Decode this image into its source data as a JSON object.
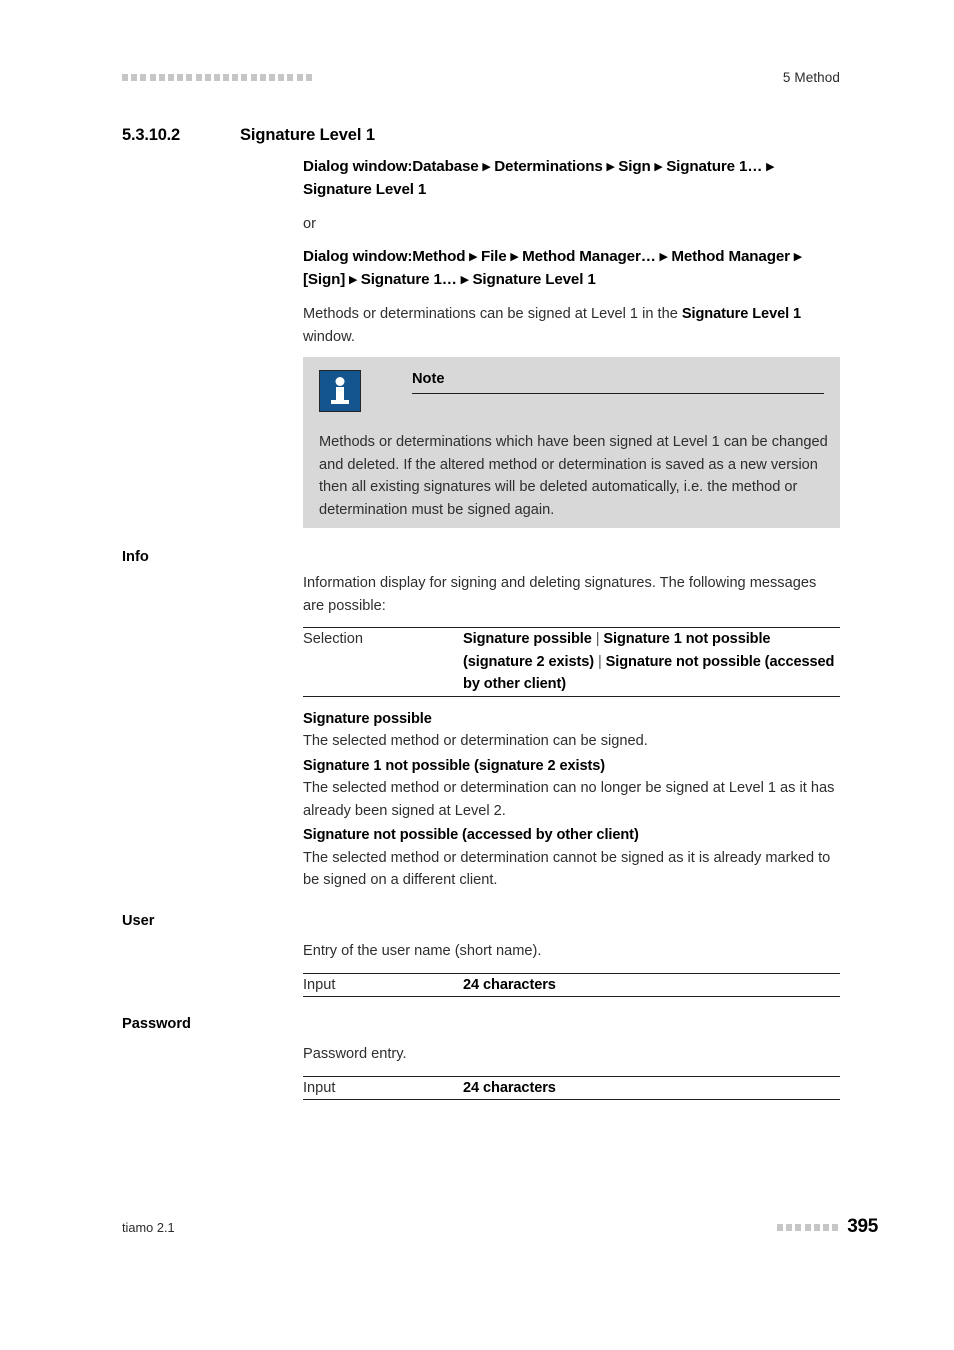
{
  "header": {
    "decor_squares": 21,
    "chapter": "5 Method"
  },
  "section": {
    "number": "5.3.10.2",
    "title": "Signature Level 1"
  },
  "breadcrumbs": {
    "path_1": "Dialog window:Database ▸ Determinations ▸ Sign ▸ Signature 1… ▸ Signature Level 1",
    "separator_word": "or",
    "path_2": "Dialog window:Method ▸ File ▸ Method Manager… ▸ Method Manager ▸ [Sign] ▸ Signature 1… ▸ Signature Level 1"
  },
  "intro": {
    "text_before": "Methods or determinations can be signed at Level 1 in the ",
    "emphasis": "Signature Level 1",
    "text_after": " window."
  },
  "note": {
    "icon": "info-icon",
    "title": "Note",
    "body": "Methods or determinations which have been signed at Level 1 can be changed and deleted. If the altered method or determination is saved as a new version then all existing signatures will be deleted automatically, i.e. the method or determination must be signed again.",
    "background_color": "#d8d8d8",
    "icon_color": "#14558f"
  },
  "info_section": {
    "label": "Info",
    "description": "Information display for signing and deleting signatures. The following messages are possible:",
    "table": {
      "key": "Selection",
      "value_parts": [
        "Signature possible",
        "Signature 1 not possible (signature 2 exists)",
        "Signature not possible (accessed by other client)"
      ],
      "value_separator": "|"
    },
    "definitions": [
      {
        "term": "Signature possible",
        "description": "The selected method or determination can be signed."
      },
      {
        "term": "Signature 1 not possible (signature 2 exists)",
        "description": "The selected method or determination can no longer be signed at Level 1 as it has already been signed at Level 2."
      },
      {
        "term": "Signature not possible (accessed by other client)",
        "description": "The selected method or determination cannot be signed as it is already marked to be signed on a different client."
      }
    ]
  },
  "user_section": {
    "label": "User",
    "description": "Entry of the user name (short name).",
    "table": {
      "key": "Input",
      "value": "24 characters"
    }
  },
  "password_section": {
    "label": "Password",
    "description": "Password entry.",
    "table": {
      "key": "Input",
      "value": "24 characters"
    }
  },
  "footer": {
    "product": "tiamo 2.1",
    "decor_squares": 7,
    "page_number": "395"
  }
}
